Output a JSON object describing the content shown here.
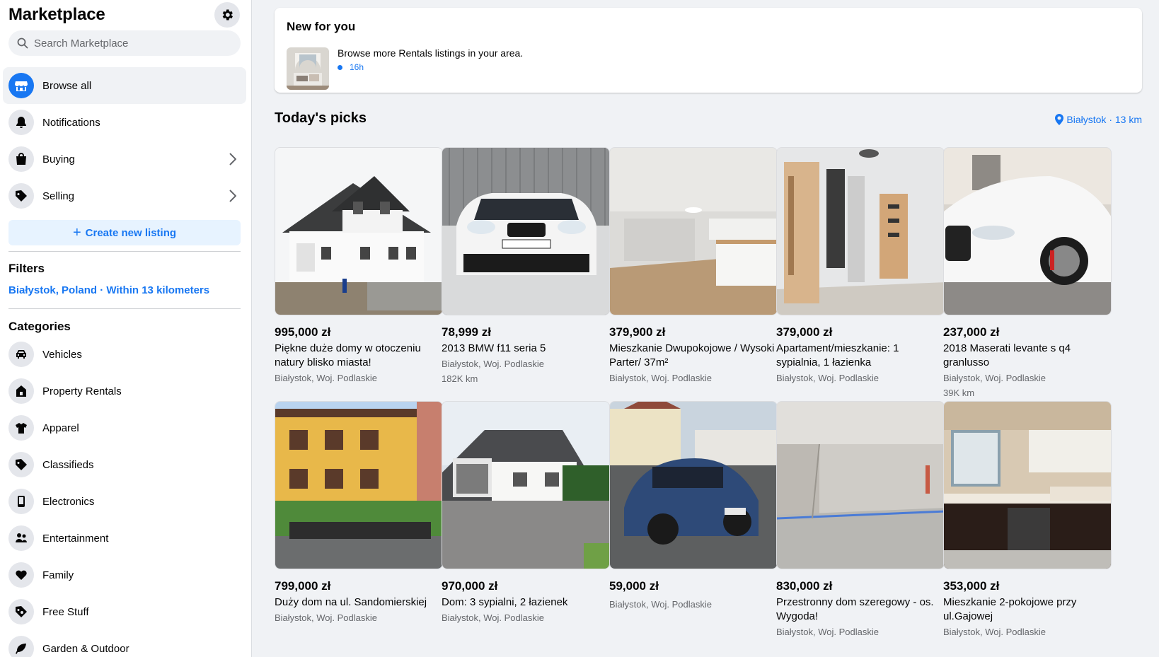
{
  "sidebar": {
    "title": "Marketplace",
    "search_placeholder": "Search Marketplace",
    "nav": [
      {
        "label": "Browse all",
        "icon": "store-icon"
      },
      {
        "label": "Notifications",
        "icon": "bell-icon"
      },
      {
        "label": "Buying",
        "icon": "shopping-bag-icon"
      },
      {
        "label": "Selling",
        "icon": "tag-icon"
      }
    ],
    "create_listing": "Create new listing",
    "filters_title": "Filters",
    "filter_location": "Białystok, Poland · Within 13 kilometers",
    "categories_title": "Categories",
    "categories": [
      {
        "label": "Vehicles",
        "icon": "car-icon"
      },
      {
        "label": "Property Rentals",
        "icon": "house-icon"
      },
      {
        "label": "Apparel",
        "icon": "shirt-icon"
      },
      {
        "label": "Classifieds",
        "icon": "tag-icon"
      },
      {
        "label": "Electronics",
        "icon": "phone-icon"
      },
      {
        "label": "Entertainment",
        "icon": "people-icon"
      },
      {
        "label": "Family",
        "icon": "heart-icon"
      },
      {
        "label": "Free Stuff",
        "icon": "free-tag-icon"
      },
      {
        "label": "Garden & Outdoor",
        "icon": "leaf-icon"
      }
    ]
  },
  "new_for_you": {
    "title": "New for you",
    "text": "Browse more Rentals listings in your area.",
    "time": "16h"
  },
  "picks": {
    "title": "Today's picks",
    "location": "Białystok · 13 km",
    "listings": [
      {
        "price": "995,000 zł",
        "title": "Piękne duże domy w otoczeniu natury blisko miasta!",
        "location": "Białystok, Woj. Podlaskie",
        "extra": ""
      },
      {
        "price": "78,999 zł",
        "title": "2013 BMW f11 seria 5",
        "location": "Białystok, Woj. Podlaskie",
        "extra": "182K km"
      },
      {
        "price": "379,900 zł",
        "title": "Mieszkanie Dwupokojowe / Wysoki Parter/ 37m²",
        "location": "Białystok, Woj. Podlaskie",
        "extra": ""
      },
      {
        "price": "379,000 zł",
        "title": "Apartament/mieszkanie: 1 sypialnia, 1 łazienka",
        "location": "Białystok, Woj. Podlaskie",
        "extra": ""
      },
      {
        "price": "237,000 zł",
        "title": "2018 Maserati levante s q4 granlusso",
        "location": "Białystok, Woj. Podlaskie",
        "extra": "39K km"
      },
      {
        "price": "799,000 zł",
        "title": "Duży dom na ul. Sandomierskiej",
        "location": "Białystok, Woj. Podlaskie",
        "extra": ""
      },
      {
        "price": "970,000 zł",
        "title": "Dom: 3 sypialni, 2 łazienek",
        "location": "Białystok, Woj. Podlaskie",
        "extra": ""
      },
      {
        "price": "59,000 zł",
        "title": "",
        "location": "Białystok, Woj. Podlaskie",
        "extra": ""
      },
      {
        "price": "830,000 zł",
        "title": "Przestronny dom szeregowy - os. Wygoda!",
        "location": "Białystok, Woj. Podlaskie",
        "extra": ""
      },
      {
        "price": "353,000 zł",
        "title": "Mieszkanie 2-pokojowe przy ul.Gajowej",
        "location": "Białystok, Woj. Podlaskie",
        "extra": ""
      }
    ]
  },
  "colors": {
    "accent": "#1877f2",
    "secondary_text": "#65676b",
    "background": "#f0f2f5"
  }
}
